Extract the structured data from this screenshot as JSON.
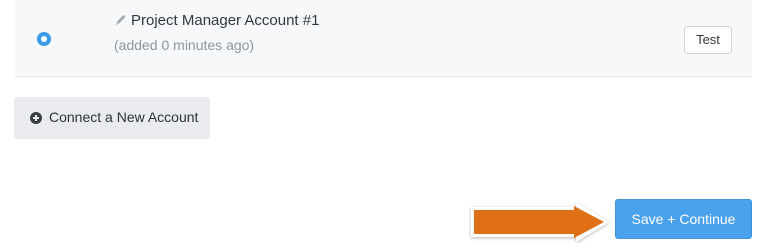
{
  "account": {
    "name": "Project Manager Account #1",
    "added": "(added 0 minutes ago)",
    "selected": true,
    "test_label": "Test",
    "radio_icon": "radio-selected-icon",
    "edit_icon": "pencil-icon"
  },
  "connect": {
    "label": "Connect a New Account",
    "icon": "plus-circle-icon"
  },
  "footer": {
    "save_label": "Save + Continue"
  },
  "annotation": {
    "icon": "arrow-right-icon",
    "color": "#e07016"
  },
  "colors": {
    "accent": "#4aa1ee",
    "radio": "#3b9ae8",
    "panel": "#f7f8fa"
  }
}
